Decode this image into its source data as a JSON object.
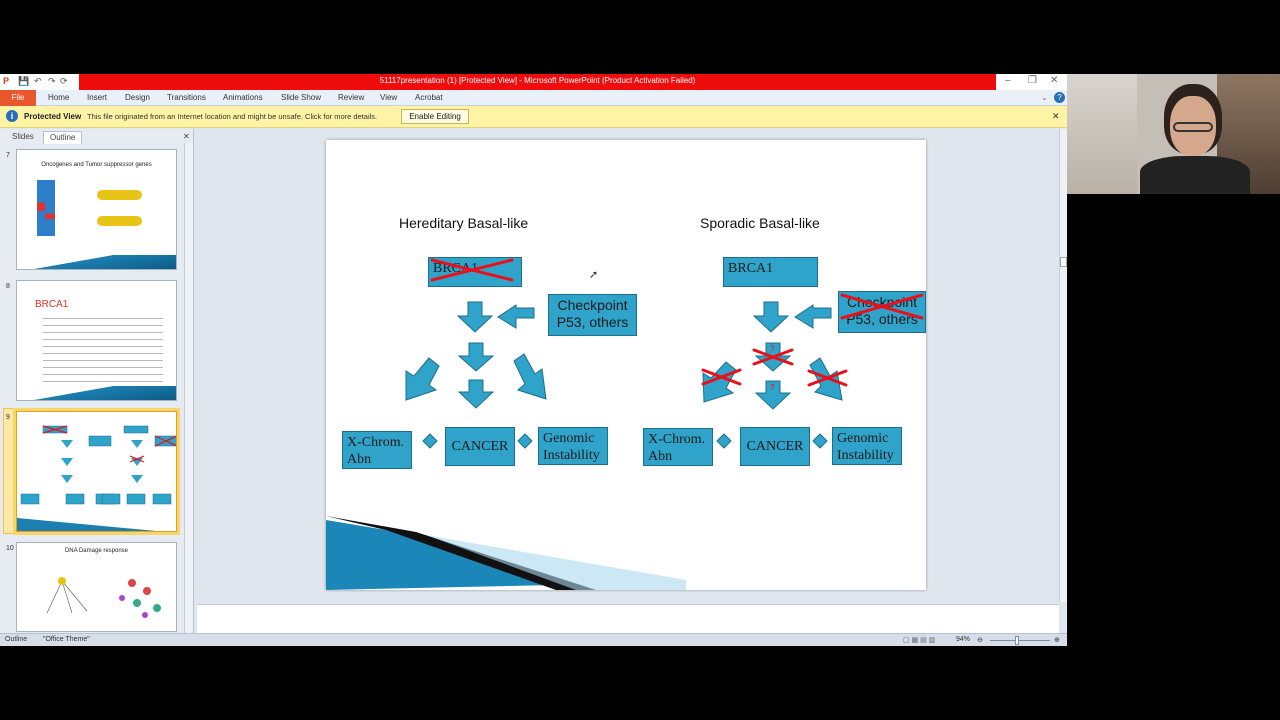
{
  "window": {
    "title": "51117presentation (1) [Protected View] - Microsoft PowerPoint (Product Activation Failed)",
    "minimize": "–",
    "restore": "❐",
    "close": "✕"
  },
  "qat": [
    "P",
    "💾",
    "↶",
    "↷",
    "⟳"
  ],
  "menu": {
    "file": "File",
    "tabs": [
      "Home",
      "Insert",
      "Design",
      "Transitions",
      "Animations",
      "Slide Show",
      "Review",
      "View",
      "Acrobat"
    ]
  },
  "protected": {
    "label": "Protected View",
    "message": "This file originated from an Internet location and might be unsafe. Click for more details.",
    "button": "Enable Editing",
    "close": "✕"
  },
  "panel": {
    "tabs": [
      "Slides",
      "Outline"
    ],
    "close": "✕",
    "slides": [
      {
        "number": "7",
        "title": "Oncogenes and Tumor suppressor genes"
      },
      {
        "number": "8",
        "title": "BRCA1"
      },
      {
        "number": "9",
        "title": ""
      },
      {
        "number": "10",
        "title": "DNA Damage response"
      }
    ]
  },
  "slide": {
    "left_title": "Hereditary Basal-like",
    "right_title": "Sporadic Basal-like",
    "brca1": "BRCA1",
    "checkpoint": "Checkpoint P53, others",
    "xchrom": "X-Chrom. Abn",
    "cancer": "CANCER",
    "genomic": "Genomic Instability",
    "question": "?"
  },
  "status": {
    "view": "Outline",
    "theme": "\"Office Theme\"",
    "zoom": "94%"
  },
  "colors": {
    "box": "#2fa3c9",
    "cross": "#e8111b",
    "titlebar": "#ee0c0c"
  }
}
